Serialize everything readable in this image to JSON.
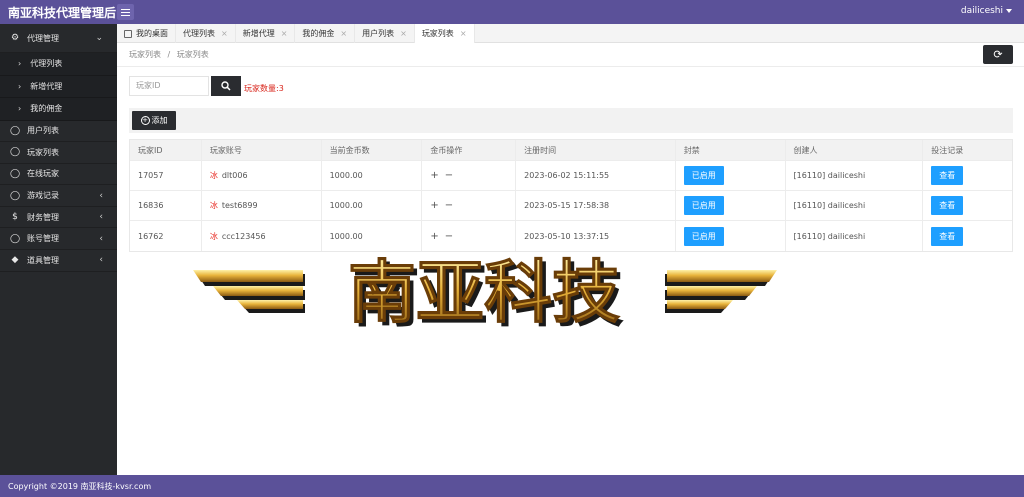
{
  "header": {
    "brand": "南亚科技代理管理后台",
    "user": "dailiceshi"
  },
  "sidebar": {
    "items": [
      {
        "label": "代理管理",
        "icon": "gear-icon",
        "expanded": true,
        "children": [
          "代理列表",
          "新增代理",
          "我的佣金"
        ]
      },
      {
        "label": "用户列表",
        "icon": "user-icon"
      },
      {
        "label": "玩家列表",
        "icon": "user-icon"
      },
      {
        "label": "在线玩家",
        "icon": "user-icon"
      },
      {
        "label": "游戏记录",
        "icon": "user-icon",
        "has_arrow": true
      },
      {
        "label": "财务管理",
        "icon": "dollar-icon",
        "has_arrow": true
      },
      {
        "label": "账号管理",
        "icon": "users-icon",
        "has_arrow": true
      },
      {
        "label": "道具管理",
        "icon": "diamond-icon",
        "has_arrow": true
      }
    ]
  },
  "tabs": [
    {
      "label": "我的桌面",
      "icon": "home-icon"
    },
    {
      "label": "代理列表"
    },
    {
      "label": "新增代理"
    },
    {
      "label": "我的佣金"
    },
    {
      "label": "用户列表"
    },
    {
      "label": "玩家列表",
      "active": true
    }
  ],
  "breadcrumb": {
    "parent": "玩家列表",
    "sep": "/",
    "current": "玩家列表"
  },
  "search": {
    "placeholder": "玩家ID",
    "count_text": "玩家数量:3"
  },
  "toolbar": {
    "add_label": "添加"
  },
  "table": {
    "columns": [
      "玩家ID",
      "玩家账号",
      "当前金币数",
      "金币操作",
      "注册时间",
      "封禁",
      "创建人",
      "投注记录"
    ],
    "rows": [
      {
        "id": "17057",
        "flag": "冰",
        "account": "dlt006",
        "coins": "1000.00",
        "ops_plus": "+",
        "ops_minus": "−",
        "time": "2023-06-02 15:11:55",
        "ban": "已启用",
        "creator": "[16110] dailiceshi",
        "view": "查看"
      },
      {
        "id": "16836",
        "flag": "冰",
        "account": "test6899",
        "coins": "1000.00",
        "ops_plus": "+",
        "ops_minus": "−",
        "time": "2023-05-15 17:58:38",
        "ban": "已启用",
        "creator": "[16110] dailiceshi",
        "view": "查看"
      },
      {
        "id": "16762",
        "flag": "冰",
        "account": "ccc123456",
        "coins": "1000.00",
        "ops_plus": "+",
        "ops_minus": "−",
        "time": "2023-05-10 13:37:15",
        "ban": "已启用",
        "creator": "[16110] dailiceshi",
        "view": "查看"
      }
    ]
  },
  "watermark": {
    "text": "南亚科技"
  },
  "footer": {
    "copyright": "Copyright ©2019 南亚科技-kvsr.com"
  },
  "colors": {
    "header": "#5b5199",
    "sidebar": "#27292c",
    "primary_button": "#1e9fff",
    "dark_button": "#2a2c30",
    "count_red": "#d9261c"
  }
}
